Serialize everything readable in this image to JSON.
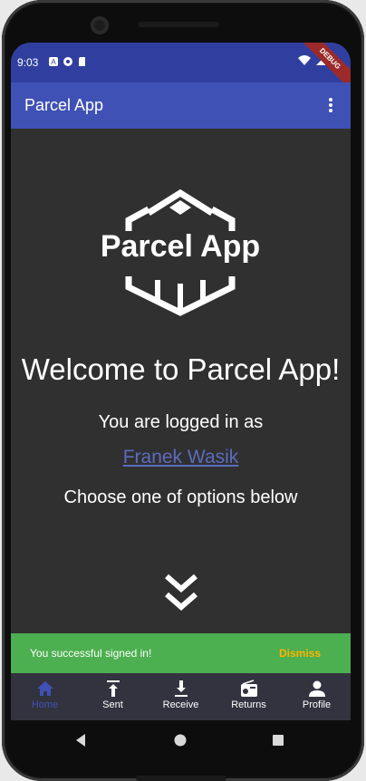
{
  "status_bar": {
    "time": "9:03",
    "debug_banner": "DEBUG"
  },
  "app_bar": {
    "title": "Parcel App"
  },
  "main": {
    "logo_text": "Parcel App",
    "welcome": "Welcome to Parcel App!",
    "logged_in_as": "You are logged in as",
    "username": "Franek Wasik",
    "choose_option": "Choose one of options below"
  },
  "snackbar": {
    "message": "You successful signed in!",
    "action": "Dismiss"
  },
  "bottom_nav": {
    "items": [
      {
        "label": "Home",
        "icon": "home-icon",
        "active": true
      },
      {
        "label": "Sent",
        "icon": "upload-icon",
        "active": false
      },
      {
        "label": "Receive",
        "icon": "download-icon",
        "active": false
      },
      {
        "label": "Returns",
        "icon": "radio-icon",
        "active": false
      },
      {
        "label": "Profile",
        "icon": "person-icon",
        "active": false
      }
    ]
  },
  "colors": {
    "status_bar": "#303f9f",
    "app_bar": "#3f51b5",
    "background": "#303030",
    "snackbar": "#4caf50",
    "snackbar_action": "#ffb300",
    "link": "#5c6bc0"
  }
}
